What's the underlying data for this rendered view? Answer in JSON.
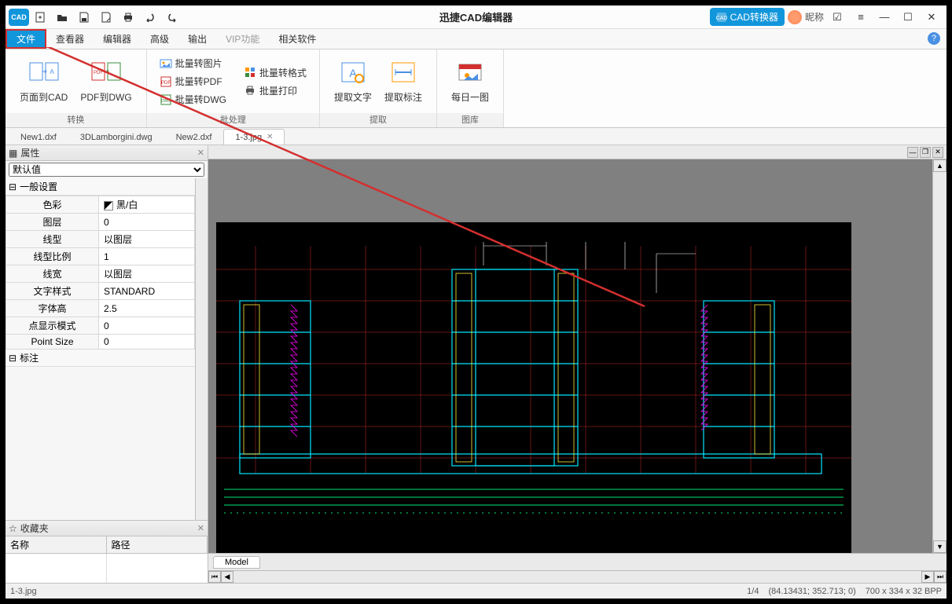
{
  "titlebar": {
    "app_title": "迅捷CAD编辑器",
    "cad_converter": "CAD转换器",
    "nickname": "昵称"
  },
  "menu": {
    "file": "文件",
    "viewer": "查看器",
    "editor": "编辑器",
    "advanced": "高级",
    "output": "输出",
    "vip": "VIP功能",
    "related": "相关软件"
  },
  "ribbon": {
    "group_convert": "转换",
    "group_batch": "批处理",
    "group_extract": "提取",
    "group_gallery": "图库",
    "page_to_cad": "页面到CAD",
    "pdf_to_dwg": "PDF到DWG",
    "batch_img": "批量转图片",
    "batch_pdf": "批量转PDF",
    "batch_dwg": "批量转DWG",
    "batch_format": "批量转格式",
    "batch_print": "批量打印",
    "extract_text": "提取文字",
    "extract_dim": "提取标注",
    "daily_image": "每日一图"
  },
  "tabs": {
    "t1": "New1.dxf",
    "t2": "3DLamborgini.dwg",
    "t3": "New2.dxf",
    "t4": "1-3.jpg"
  },
  "props": {
    "panel_title": "属性",
    "default_val": "默认值",
    "section_general": "一般设置",
    "section_dim": "标注",
    "color": "色彩",
    "color_val": "黑/白",
    "layer": "图层",
    "layer_val": "0",
    "linetype": "线型",
    "linetype_val": "以图层",
    "ltscale": "线型比例",
    "ltscale_val": "1",
    "lineweight": "线宽",
    "lineweight_val": "以图层",
    "textstyle": "文字样式",
    "textstyle_val": "STANDARD",
    "textheight": "字体高",
    "textheight_val": "2.5",
    "pointmode": "点显示模式",
    "pointmode_val": "0",
    "pointsize": "Point Size",
    "pointsize_val": "0"
  },
  "favorites": {
    "panel_title": "收藏夹",
    "col_name": "名称",
    "col_path": "路径"
  },
  "model_tab": "Model",
  "status": {
    "file": "1-3.jpg",
    "page": "1/4",
    "coords": "(84.13431; 352.713; 0)",
    "dims": "700 x 334 x 32 BPP"
  }
}
